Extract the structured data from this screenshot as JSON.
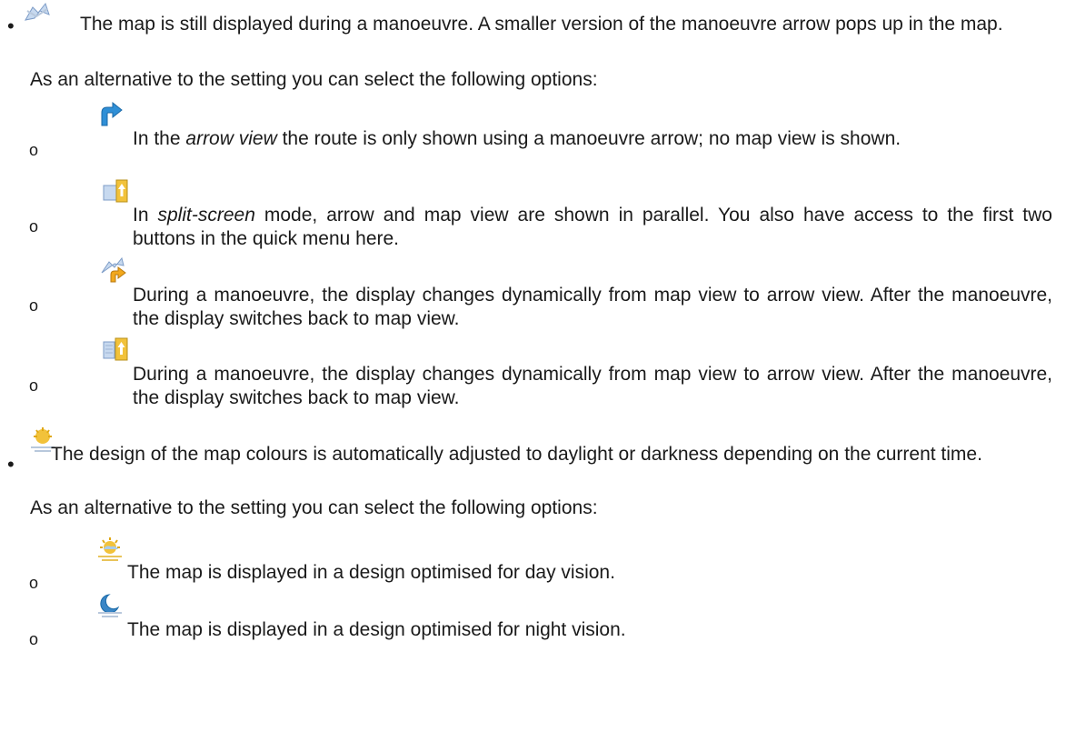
{
  "section1": {
    "icon": "map-arrow-view-icon",
    "text": "The map is still displayed during a manoeuvre. A smaller version of the manoeuvre arrow pops up in the map.",
    "alternative": "As an alternative to the setting you can select the following options:",
    "options": [
      {
        "icon": "arrow-view-icon",
        "before": "In the ",
        "em": "arrow view",
        "after": " the route is only shown using a manoeuvre arrow; no map view is shown."
      },
      {
        "icon": "split-screen-icon",
        "before": "In ",
        "em": "split-screen",
        "after": " mode, arrow and map view are shown in parallel. You also have access to the first two buttons in the quick menu here."
      },
      {
        "icon": "dynamic-arrow-view-icon",
        "text": "During a manoeuvre, the display changes dynamically from map view to arrow view. After the manoeuvre, the display switches back to map view."
      },
      {
        "icon": "dynamic-split-screen-icon",
        "text": "During a manoeuvre, the display changes dynamically from map view to arrow view. After the manoeuvre, the display switches back to map view."
      }
    ]
  },
  "section2": {
    "icon": "day-night-auto-icon",
    "text": "The design of the map colours is automatically adjusted to daylight or darkness depending on the current time.",
    "alternative": "As an alternative to the setting you can select the following options:",
    "options": [
      {
        "icon": "day-mode-icon",
        "text": "The map is displayed in a design optimised for day vision."
      },
      {
        "icon": "night-mode-icon",
        "text": "The map is displayed in a design optimised for night vision."
      }
    ]
  },
  "markers": {
    "bullet": "•",
    "sub_bullet": "o"
  }
}
